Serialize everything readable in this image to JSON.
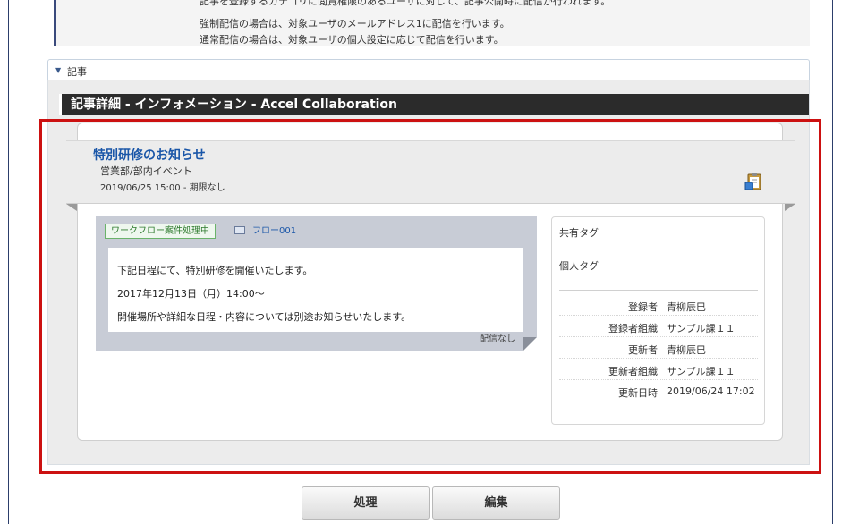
{
  "notes": {
    "line_cut": "記事を登録するカテゴリに閲覧権限のあるユーザに対して、記事公開時に配信が行われます。",
    "line_forced": "強制配信の場合は、対象ユーザのメールアドレス1に配信を行います。",
    "line_normal": "通常配信の場合は、対象ユーザの個人設定に応じて配信を行います。"
  },
  "section": {
    "label": "記事"
  },
  "page_title": "記事詳細 - インフォメーション - Accel Collaboration",
  "article": {
    "title": "特別研修のお知らせ",
    "category": "営業部/部内イベント",
    "period": "2019/06/25 15:00 - 期限なし",
    "icon": "clipboard-icon"
  },
  "workflow": {
    "status": "ワークフロー案件処理中",
    "flow_icon": "window-icon",
    "flow_name": "フロー001"
  },
  "body": {
    "line1": "下記日程にて、特別研修を開催いたします。",
    "line2": "2017年12月13日（月）14:00～",
    "line3": "開催場所や詳細な日程・内容については別途お知らせいたします。",
    "delivery": "配信なし"
  },
  "tags": {
    "shared": "共有タグ",
    "personal": "個人タグ"
  },
  "meta": [
    {
      "key": "登録者",
      "value": "青柳辰巳"
    },
    {
      "key": "登録者組織",
      "value": "サンプル課１１"
    },
    {
      "key": "更新者",
      "value": "青柳辰巳"
    },
    {
      "key": "更新者組織",
      "value": "サンプル課１１"
    },
    {
      "key": "更新日時",
      "value": "2019/06/24 17:02"
    }
  ],
  "actions": {
    "process": "処理",
    "edit": "編集"
  },
  "colors": {
    "highlight": "#cc1111",
    "title_bar": "#2b2b2b",
    "link": "#1a56a8"
  }
}
